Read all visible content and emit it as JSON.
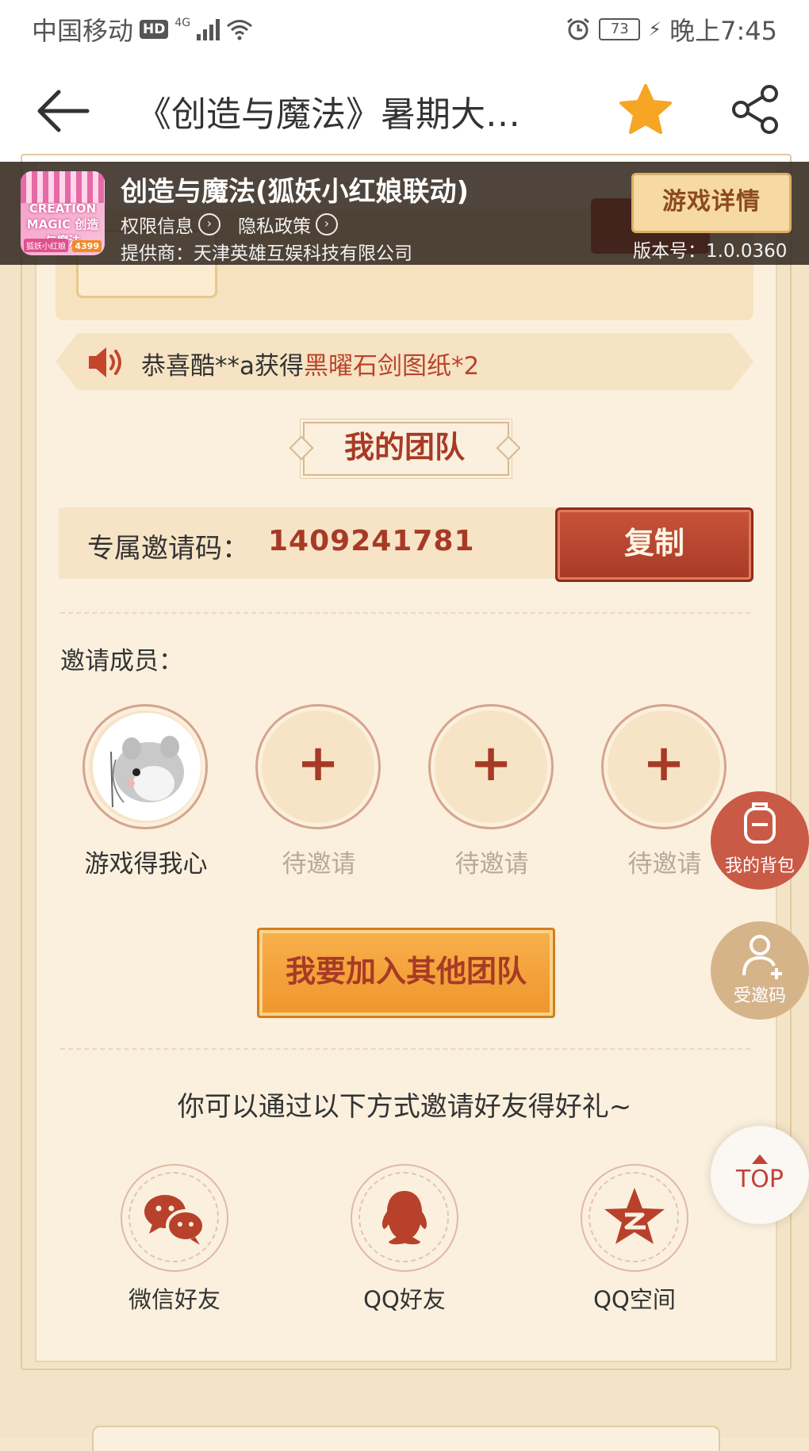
{
  "status_bar": {
    "carrier": "中国移动",
    "hd": "HD",
    "network": "4G",
    "battery": "73",
    "time": "晚上7:45"
  },
  "nav": {
    "title": "《创造与魔法》暑期大…",
    "back_icon": "arrow-left-icon",
    "favorite_icon": "star-icon",
    "share_icon": "share-icon"
  },
  "app_bar": {
    "name": "创造与魔法(狐妖小红娘联动)",
    "permission": "权限信息",
    "privacy": "隐私政策",
    "provider": "提供商：天津英雄互娱科技有限公司",
    "detail_button": "游戏详情",
    "version": "版本号：1.0.0360",
    "icon_text": "CREATION MAGIC 创造与魔法",
    "icon_tag": "狐妖小红娘",
    "icon_brand": "4399"
  },
  "notice": {
    "prefix": "恭喜酷**a获得",
    "item": "黑曜石剑图纸*2"
  },
  "team": {
    "title": "我的团队",
    "code_label": "专属邀请码：",
    "code_value": "1409241781",
    "copy_button": "复制",
    "members_label": "邀请成员：",
    "members": [
      {
        "name": "游戏得我心",
        "status": "joined"
      },
      {
        "name": "待邀请",
        "status": "pending"
      },
      {
        "name": "待邀请",
        "status": "pending"
      },
      {
        "name": "待邀请",
        "status": "pending"
      }
    ],
    "join_button": "我要加入其他团队"
  },
  "share": {
    "title": "你可以通过以下方式邀请好友得好礼~",
    "options": [
      {
        "label": "微信好友",
        "icon": "wechat-icon"
      },
      {
        "label": "QQ好友",
        "icon": "qq-icon"
      },
      {
        "label": "QQ空间",
        "icon": "qzone-icon"
      }
    ]
  },
  "floating": {
    "bag": "我的背包",
    "invite_code": "受邀码",
    "top": "TOP"
  },
  "colors": {
    "accent_red": "#a73a26",
    "orange": "#f8b14c",
    "background": "#fbf0de"
  }
}
